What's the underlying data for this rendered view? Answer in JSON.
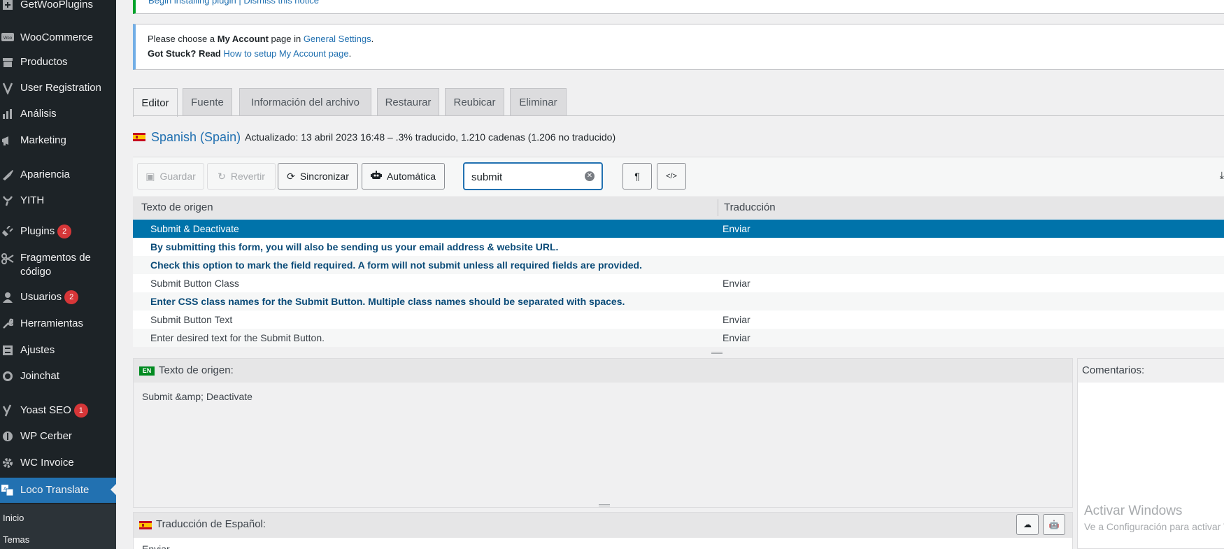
{
  "sidebar": {
    "items": [
      {
        "label": "GetWooPlugins",
        "icon": "plugin-plus-icon"
      },
      {
        "label": "WooCommerce",
        "icon": "woo-icon"
      },
      {
        "label": "Productos",
        "icon": "archive-icon"
      },
      {
        "label": "User Registration",
        "icon": "user-registration-icon"
      },
      {
        "label": "Análisis",
        "icon": "chart-bar-icon"
      },
      {
        "label": "Marketing",
        "icon": "megaphone-icon"
      },
      {
        "label": "Apariencia",
        "icon": "brush-icon"
      },
      {
        "label": "YITH",
        "icon": "yith-icon"
      },
      {
        "label": "Plugins",
        "icon": "plugins-icon",
        "badge": "2"
      },
      {
        "label": "Fragmentos de código",
        "icon": "scissors-icon"
      },
      {
        "label": "Usuarios",
        "icon": "user-icon",
        "badge": "2"
      },
      {
        "label": "Herramientas",
        "icon": "wrench-icon"
      },
      {
        "label": "Ajustes",
        "icon": "settings-icon"
      },
      {
        "label": "Joinchat",
        "icon": "whatsapp-icon"
      },
      {
        "label": "Yoast SEO",
        "icon": "yoast-icon",
        "badge": "1"
      },
      {
        "label": "WP Cerber",
        "icon": "shield-icon"
      },
      {
        "label": "WC Invoice",
        "icon": "gear-icon"
      },
      {
        "label": "Loco Translate",
        "icon": "translate-icon"
      }
    ],
    "submenu": [
      "Inicio",
      "Temas"
    ]
  },
  "notices": {
    "top": "Begin installing plugin | Dismiss this notice",
    "account": {
      "line1_pre": "Please choose a ",
      "line1_bold": "My Account",
      "line1_mid": " page in ",
      "line1_link": "General Settings",
      "line1_post": ".",
      "line2_bold": "Got Stuck? Read ",
      "line2_link": "How to setup My Account page",
      "line2_post": "."
    }
  },
  "tabs": [
    "Editor",
    "Fuente",
    "Información del archivo",
    "Restaurar",
    "Reubicar",
    "Eliminar"
  ],
  "locale": {
    "name": "Spanish (Spain)",
    "status": "Actualizado: 13 abril 2023 16:48 – .3% traducido, 1.210 cadenas (1.206 no traducido)"
  },
  "toolbar": {
    "save": "Guardar",
    "revert": "Revertir",
    "sync": "Sincronizar",
    "auto": "Automática",
    "search_value": "submit",
    "pilcrow": "¶",
    "code": "</>"
  },
  "table": {
    "headers": {
      "source": "Texto de origen",
      "translation": "Traducción"
    },
    "rows": [
      {
        "source": "Submit & Deactivate",
        "translation": "Enviar"
      },
      {
        "source": "By submitting this form, you will also be sending us your email address & website URL.",
        "translation": ""
      },
      {
        "source": "Check this option to mark the field required. A form will not submit unless all required fields are provided.",
        "translation": ""
      },
      {
        "source": "Submit Button Class",
        "translation": "Enviar"
      },
      {
        "source": "Enter CSS class names for the Submit Button. Multiple class names should be separated with spaces.",
        "translation": ""
      },
      {
        "source": "Submit Button Text",
        "translation": "Enviar"
      },
      {
        "source": "Enter desired text for the Submit Button.",
        "translation": "Enviar"
      }
    ]
  },
  "editor": {
    "en_badge": "EN",
    "source_label": "Texto de origen:",
    "source_text": "Submit &amp; Deactivate",
    "comments_label": "Comentarios:",
    "target_label": "Traducción de Español:",
    "target_text": "Enviar"
  },
  "watermark": {
    "line1": "Activar Windows",
    "line2": "Ve a Configuración para activar Windows."
  }
}
